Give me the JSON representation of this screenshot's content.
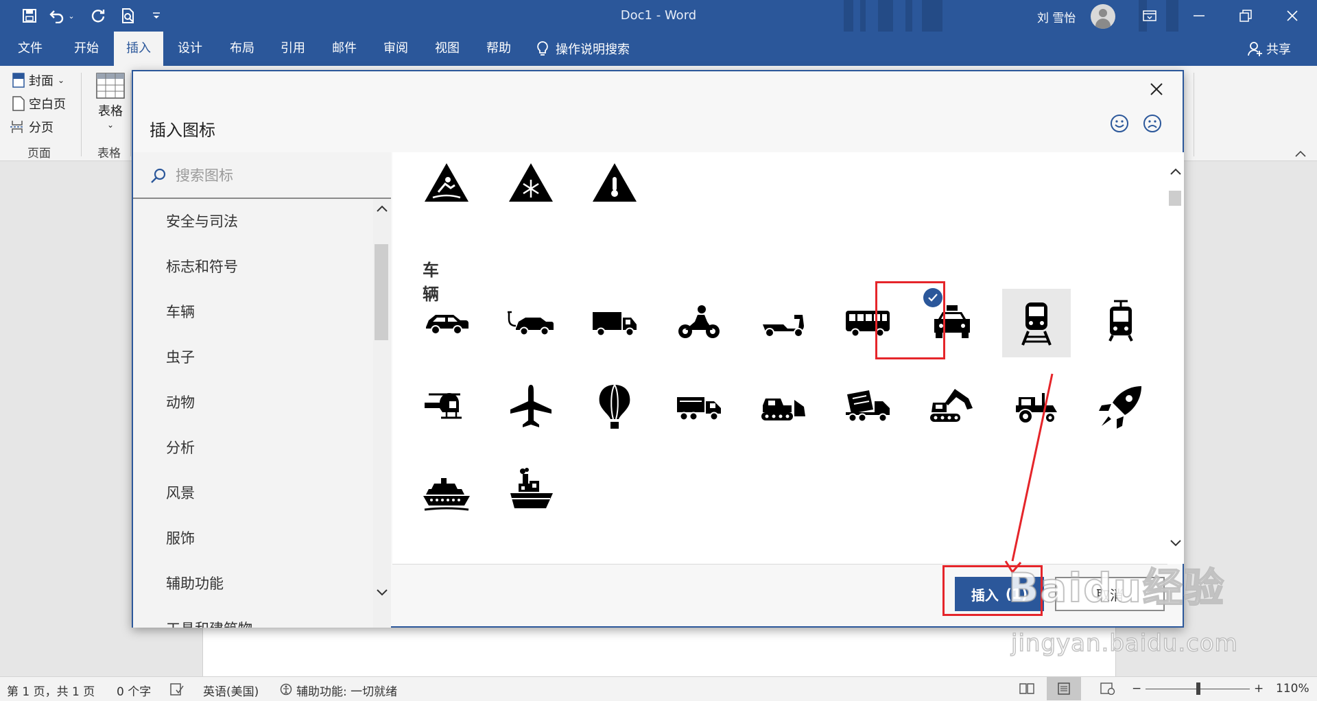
{
  "titlebar": {
    "doc_title": "Doc1  -  Word",
    "user_name": "刘 雪怡",
    "qa_icons": [
      "save-icon",
      "undo-icon",
      "redo-icon",
      "print-preview-icon",
      "customize-icon"
    ]
  },
  "menu": {
    "items": [
      "文件",
      "开始",
      "插入",
      "设计",
      "布局",
      "引用",
      "邮件",
      "审阅",
      "视图",
      "帮助"
    ],
    "active": "插入",
    "tell_me": "操作说明搜索",
    "share": "共享"
  },
  "ribbon": {
    "pages": {
      "cover": "封面",
      "blank": "空白页",
      "break": "分页",
      "group": "页面"
    },
    "tables": {
      "table": "表格",
      "group": "表格"
    }
  },
  "dialog": {
    "title": "插入图标",
    "search_placeholder": "搜索图标",
    "categories": [
      "安全与司法",
      "标志和符号",
      "车辆",
      "虫子",
      "动物",
      "分析",
      "风景",
      "服饰",
      "辅助功能",
      "工具和建筑物"
    ],
    "section_label": "车辆",
    "icons_top": [
      "slippery-warning-icon",
      "snowflake-warning-icon",
      "temperature-warning-icon"
    ],
    "vehicle_icons": [
      "car-icon",
      "electric-car-icon",
      "truck-icon",
      "motorcycle-icon",
      "scooter-icon",
      "bus-icon",
      "taxi-icon",
      "train-icon",
      "tram-icon",
      "helicopter-icon",
      "airplane-icon",
      "hot-air-balloon-icon",
      "dump-truck-icon",
      "bulldozer-icon",
      "cement-mixer-icon",
      "excavator-icon",
      "tractor-icon",
      "rocket-icon",
      "cruise-ship-icon",
      "steamboat-icon"
    ],
    "selected_icon": "train-icon",
    "insert_label": "插入",
    "insert_count": "(1)",
    "cancel_label": "取消"
  },
  "statusbar": {
    "page": "第 1 页，共 1 页",
    "words": "0 个字",
    "language": "英语(美国)",
    "accessibility": "辅助功能: 一切就绪",
    "zoom": "110%"
  },
  "watermark": {
    "brand": "Baidu经验",
    "url": "jingyan.baidu.com"
  },
  "colors": {
    "accent": "#2b579a",
    "highlight": "#e5252a"
  }
}
